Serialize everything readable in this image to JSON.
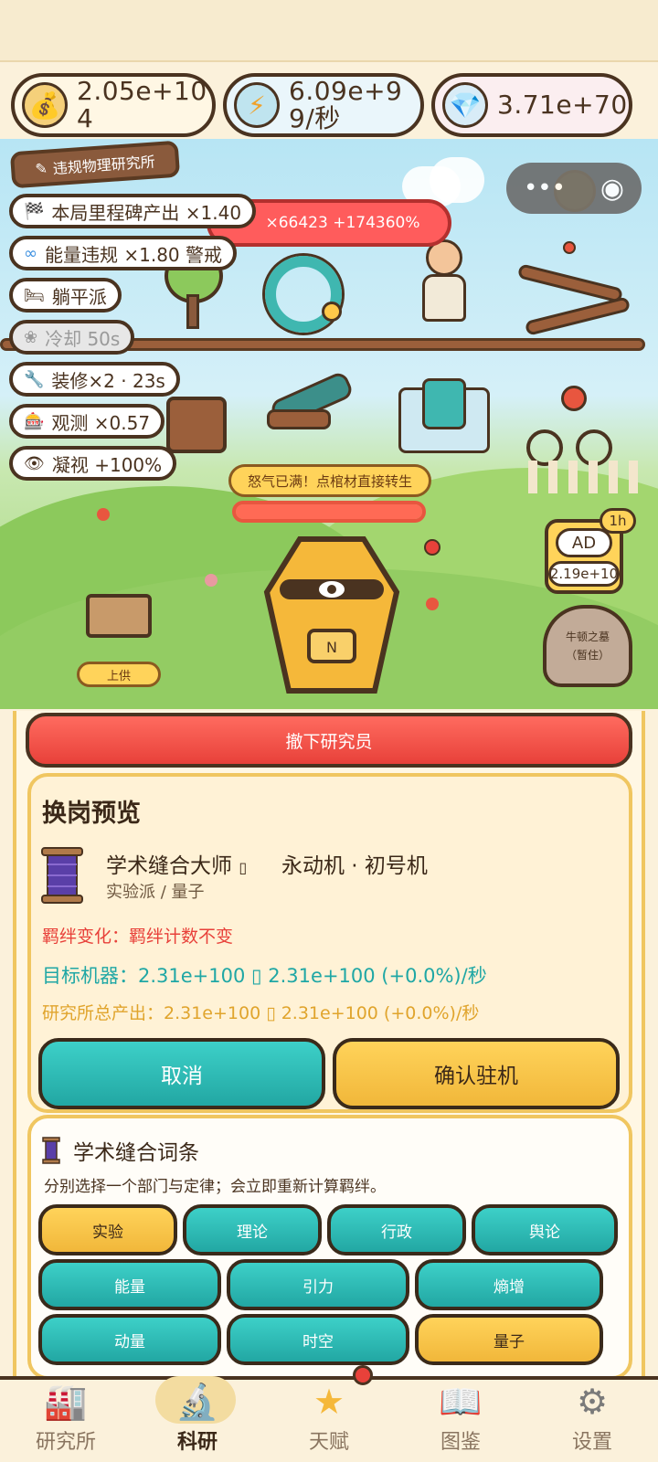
{
  "resources": {
    "coins": "2.05e+104",
    "energy": "6.09e+99/秒",
    "gems": "3.71e+70"
  },
  "scene": {
    "lab_title": "违规物理研究所",
    "red_bar": "×66423 +174360%",
    "tags": [
      {
        "icon": "checkered-flag",
        "text": "本局里程碑产出 ×1.40"
      },
      {
        "icon": "infinity",
        "text": "能量违规 ×1.80 警戒"
      },
      {
        "icon": "bed",
        "text": "躺平派"
      },
      {
        "icon": "leaf",
        "text": "冷却 50s"
      },
      {
        "icon": "wrench",
        "text": "装修×2 · 23s"
      },
      {
        "icon": "slot-machine",
        "text": "观测 ×0.57"
      },
      {
        "icon": "eye",
        "text": "凝视 +100%"
      }
    ],
    "rage_label": "怒气已满！点棺材直接转生",
    "rage_progress": 1.0,
    "offer_button": "上供",
    "ad": {
      "label": "AD",
      "value": "2.19e+10",
      "badge": "1h"
    },
    "tomb_title": "牛顿之墓",
    "tomb_sub": "（暂住）",
    "coffin_letter": "N"
  },
  "panel": {
    "unseat_button": "撤下研究员",
    "preview_title": "换岗预览",
    "researcher_name": "学术缝合大师",
    "arrow_glyph": "▯",
    "machine_name": "永动机 · 初号机",
    "researcher_tags": "实验派 / 量子",
    "bond_change": "羁绊变化：羁绊计数不变",
    "target_machine": "目标机器：2.31e+100 ▯  2.31e+100 (+0.0%)/秒",
    "lab_output": "研究所总产出：2.31e+100 ▯  2.31e+100 (+0.0%)/秒",
    "cancel_button": "取消",
    "confirm_button": "确认驻机",
    "traits_title": "学术缝合词条",
    "traits_desc": "分别选择一个部门与定律；会立即重新计算羁绊。",
    "departments": [
      {
        "label": "实验",
        "selected": true
      },
      {
        "label": "理论",
        "selected": false
      },
      {
        "label": "行政",
        "selected": false
      },
      {
        "label": "舆论",
        "selected": false
      }
    ],
    "laws_row1": [
      {
        "label": "能量",
        "selected": false
      },
      {
        "label": "引力",
        "selected": false
      },
      {
        "label": "熵增",
        "selected": false
      }
    ],
    "laws_row2": [
      {
        "label": "动量",
        "selected": false
      },
      {
        "label": "时空",
        "selected": false
      },
      {
        "label": "量子",
        "selected": true
      }
    ]
  },
  "nav": {
    "items": [
      {
        "label": "研究所",
        "icon": "factory-icon"
      },
      {
        "label": "科研",
        "icon": "microscope-icon"
      },
      {
        "label": "天赋",
        "icon": "star-icon"
      },
      {
        "label": "图鉴",
        "icon": "book-icon"
      },
      {
        "label": "设置",
        "icon": "gear-icon"
      }
    ],
    "active_index": 1
  },
  "colors": {
    "teal": "#22a7a3",
    "gold": "#f1b73a",
    "red": "#e8413a",
    "outline": "#4a3320"
  }
}
